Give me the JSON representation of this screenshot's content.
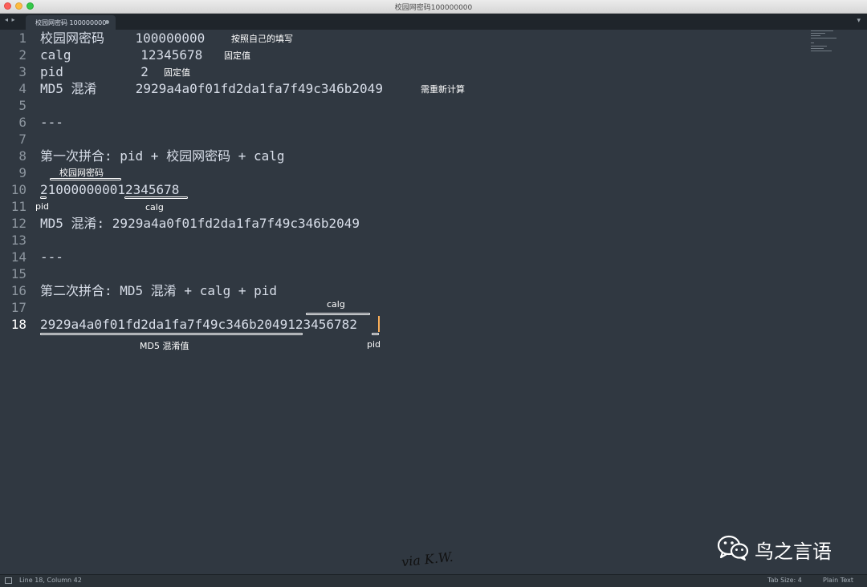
{
  "window": {
    "title": "校园网密码100000000"
  },
  "tabbar": {
    "nav_arrows": "◂ ▸",
    "tab_label": "校园网密码 100000000",
    "menu_glyph": "▾"
  },
  "gutter": [
    "1",
    "2",
    "3",
    "4",
    "5",
    "6",
    "7",
    "8",
    "9",
    "10",
    "11",
    "12",
    "13",
    "14",
    "15",
    "16",
    "17",
    "18"
  ],
  "active_line": "18",
  "lines": {
    "l1": "校园网密码    100000000",
    "l2": "calg         12345678",
    "l3": "pid          2",
    "l4": "MD5 混淆     2929a4a0f01fd2da1fa7f49c346b2049",
    "l6": "---",
    "l8": "第一次拼合: pid + 校园网密码 + calg",
    "l10": "210000000012345678",
    "l12": "MD5 混淆: 2929a4a0f01fd2da1fa7f49c346b2049",
    "l14": "---",
    "l16": "第二次拼合: MD5 混淆 + calg + pid",
    "l18": "2929a4a0f01fd2da1fa7f49c346b2049123456782"
  },
  "notes": {
    "n1": "按照自己的填写",
    "n2": "固定值",
    "n3": "固定值",
    "n4": "需重新计算"
  },
  "annotations": {
    "first_password": "校园网密码",
    "first_pid": "pid",
    "first_calg": "calg",
    "second_calg": "calg",
    "second_md5": "MD5 混淆值",
    "second_pid": "pid"
  },
  "statusbar": {
    "position": "Line 18, Column 42",
    "tab_size": "Tab Size: 4",
    "syntax": "Plain Text"
  },
  "watermark": {
    "text": "鸟之言语",
    "signature": "via K.W."
  },
  "colors": {
    "background": "#303841",
    "text": "#d8dee9",
    "cursor": "#f9ae58"
  }
}
